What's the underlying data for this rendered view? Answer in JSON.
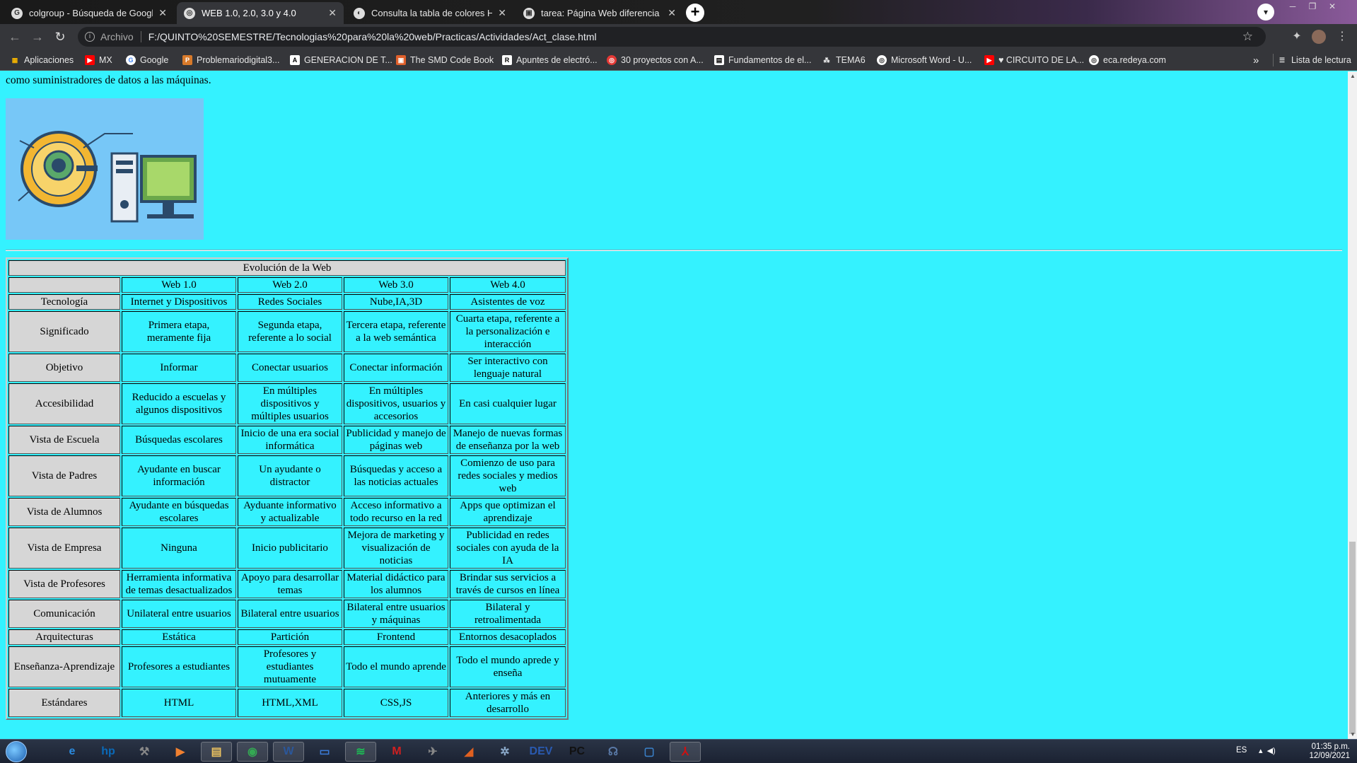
{
  "browser": {
    "tabs": [
      {
        "title": "colgroup - Búsqueda de Google",
        "icon": "G"
      },
      {
        "title": "WEB 1.0, 2.0, 3.0 y 4.0",
        "icon": "◎"
      },
      {
        "title": "Consulta la tabla de colores HTML",
        "icon": "◐"
      },
      {
        "title": "tarea: Página Web diferencia de",
        "icon": "▣"
      }
    ],
    "new_tab": "+",
    "address": {
      "scheme_label": "Archivo",
      "url": "F:/QUINTO%20SEMESTRE/Tecnologias%20para%20la%20web/Practicas/Actividades/Act_clase.html"
    },
    "bookmarks": [
      {
        "label": "Aplicaciones",
        "icon": "apps-grid-icon",
        "color": "#f5b400"
      },
      {
        "label": "MX",
        "icon": "youtube-icon",
        "color": "#ff0000"
      },
      {
        "label": "Google",
        "icon": "google-icon",
        "color": "#ffffff"
      },
      {
        "label": "Problemariodigital3...",
        "icon": "bookmark-icon",
        "color": "#d87a2a"
      },
      {
        "label": "GENERACION DE T...",
        "icon": "letter-a-icon",
        "color": "#ffffff"
      },
      {
        "label": "The SMD Code Book",
        "icon": "book-icon",
        "color": "#e0602b"
      },
      {
        "label": "Apuntes de electró...",
        "icon": "notes-icon",
        "color": "#ffffff"
      },
      {
        "label": "30 proyectos con A...",
        "icon": "target-icon",
        "color": "#e53935"
      },
      {
        "label": "Fundamentos de el...",
        "icon": "document-icon",
        "color": "#ffffff"
      },
      {
        "label": "TEMA6",
        "icon": "network-icon",
        "color": "#ffffff"
      },
      {
        "label": "Microsoft Word - U...",
        "icon": "globe-icon",
        "color": "#ffffff"
      },
      {
        "label": "♥ CIRCUITO DE LA...",
        "icon": "youtube-icon",
        "color": "#ff0000"
      },
      {
        "label": "eca.redeya.com",
        "icon": "globe-icon",
        "color": "#ffffff"
      }
    ],
    "overflow": "»",
    "reading_list": "Lista de lectura"
  },
  "page": {
    "intro_text": "como suministradores de datos a las máquinas.",
    "table": {
      "caption": "Evolución de la Web",
      "corner": "",
      "columns": [
        "Web 1.0",
        "Web 2.0",
        "Web 3.0",
        "Web 4.0"
      ],
      "rows": [
        {
          "label": "Tecnología",
          "cells": [
            "Internet y Dispositivos",
            "Redes Sociales",
            "Nube,IA,3D",
            "Asistentes de voz"
          ]
        },
        {
          "label": "Significado",
          "cells": [
            "Primera etapa, meramente fija",
            "Segunda etapa, referente a lo social",
            "Tercera etapa, referente a la web semántica",
            "Cuarta etapa, referente a la personalización e interacción"
          ]
        },
        {
          "label": "Objetivo",
          "cells": [
            "Informar",
            "Conectar usuarios",
            "Conectar información",
            "Ser interactivo con lenguaje natural"
          ]
        },
        {
          "label": "Accesibilidad",
          "cells": [
            "Reducido a escuelas y algunos dispositivos",
            "En múltiples dispositivos y múltiples usuarios",
            "En múltiples dispositivos, usuarios y accesorios",
            "En casi cualquier lugar"
          ]
        },
        {
          "label": "Vista de Escuela",
          "cells": [
            "Búsquedas escolares",
            "Inicio de una era social informática",
            "Publicidad y manejo de páginas web",
            "Manejo de nuevas formas de enseñanza por la web"
          ]
        },
        {
          "label": "Vista de Padres",
          "cells": [
            "Ayudante en buscar información",
            "Un ayudante o distractor",
            "Búsquedas y acceso a las noticias actuales",
            "Comienzo de uso para redes sociales y medios web"
          ]
        },
        {
          "label": "Vista de Alumnos",
          "cells": [
            "Ayudante en búsquedas escolares",
            "Ayduante informativo y actualizable",
            "Acceso informativo a todo recurso en la red",
            "Apps que optimizan el aprendizaje"
          ]
        },
        {
          "label": "Vista de Empresa",
          "cells": [
            "Ninguna",
            "Inicio publicitario",
            "Mejora de marketing y visualización de noticias",
            "Publicidad en redes sociales con ayuda de la IA"
          ]
        },
        {
          "label": "Vista de Profesores",
          "cells": [
            "Herramienta informativa de temas desactualizados",
            "Apoyo para desarrollar temas",
            "Material didáctico para los alumnos",
            "Brindar sus servicios a través de cursos en línea"
          ]
        },
        {
          "label": "Comunicación",
          "cells": [
            "Unilateral entre usuarios",
            "Bilateral entre usuarios",
            "Bilateral entre usuarios y máquinas",
            "Bilateral y retroalimentada"
          ]
        },
        {
          "label": "Arquitecturas",
          "cells": [
            "Estática",
            "Partición",
            "Frontend",
            "Entornos desacoplados"
          ]
        },
        {
          "label": "Enseñanza-Aprendizaje",
          "cells": [
            "Profesores a estudiantes",
            "Profesores y estudiantes mutuamente",
            "Todo el mundo aprende",
            "Todo el mundo aprede y enseña"
          ]
        },
        {
          "label": "Estándares",
          "cells": [
            "HTML",
            "HTML,XML",
            "CSS,JS",
            "Anteriores y más en desarrollo"
          ]
        }
      ]
    }
  },
  "taskbar": {
    "apps": [
      {
        "name": "internet-explorer-icon",
        "label": "e",
        "color": "#2a8be0",
        "open": false
      },
      {
        "name": "hp-icon",
        "label": "hp",
        "color": "#0a6ab8",
        "open": false
      },
      {
        "name": "tool-icon",
        "label": "⚒",
        "color": "#888888",
        "open": false
      },
      {
        "name": "media-player-icon",
        "label": "▶",
        "color": "#f08030",
        "open": false
      },
      {
        "name": "file-explorer-icon",
        "label": "▤",
        "color": "#e8c060",
        "open": true
      },
      {
        "name": "chrome-icon",
        "label": "◉",
        "color": "#34a853",
        "open": true
      },
      {
        "name": "word-icon",
        "label": "W",
        "color": "#2b579a",
        "open": true
      },
      {
        "name": "app-icon",
        "label": "▭",
        "color": "#3a7ad8",
        "open": false
      },
      {
        "name": "spotify-icon",
        "label": "≋",
        "color": "#1db954",
        "open": true
      },
      {
        "name": "mplab-icon",
        "label": "M",
        "color": "#d02020",
        "open": false
      },
      {
        "name": "robot-icon",
        "label": "✈",
        "color": "#888888",
        "open": false
      },
      {
        "name": "matlab-icon",
        "label": "◢",
        "color": "#e06020",
        "open": false
      },
      {
        "name": "atom-icon",
        "label": "✲",
        "color": "#8aa8c8",
        "open": false
      },
      {
        "name": "devcpp-icon",
        "label": "DEV",
        "color": "#2a5ab0",
        "open": false
      },
      {
        "name": "pycharm-icon",
        "label": "PC",
        "color": "#111111",
        "open": false
      },
      {
        "name": "postgres-icon",
        "label": "☊",
        "color": "#5a7aa8",
        "open": false
      },
      {
        "name": "virtualbox-icon",
        "label": "▢",
        "color": "#3a80c8",
        "open": false
      },
      {
        "name": "acrobat-icon",
        "label": "⅄",
        "color": "#d01010",
        "open": true
      }
    ],
    "language": "ES",
    "time": "01:35 p.m.",
    "date": "12/09/2021"
  }
}
